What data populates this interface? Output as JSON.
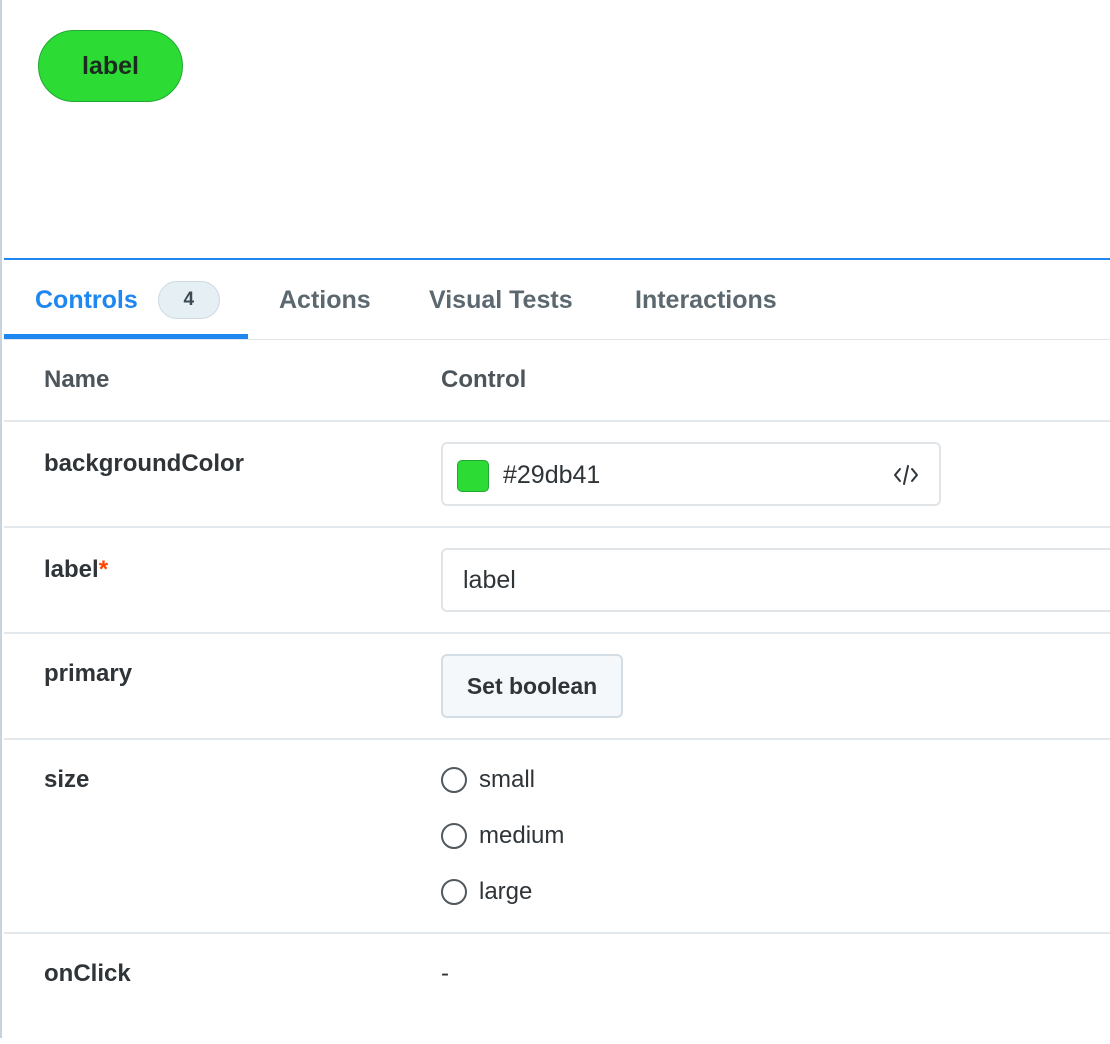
{
  "preview": {
    "button_label": "label",
    "button_color": "#2cdc35"
  },
  "tabs": {
    "controls_label": "Controls",
    "controls_count": "4",
    "actions_label": "Actions",
    "visual_tests_label": "Visual Tests",
    "interactions_label": "Interactions"
  },
  "table": {
    "header_name": "Name",
    "header_control": "Control",
    "rows": {
      "background_color": {
        "name": "backgroundColor",
        "value": "#29db41",
        "swatch_color": "#2cdc35"
      },
      "label": {
        "name": "label",
        "required_mark": "*",
        "value": "label"
      },
      "primary": {
        "name": "primary",
        "button_label": "Set boolean"
      },
      "size": {
        "name": "size",
        "options": [
          "small",
          "medium",
          "large"
        ]
      },
      "on_click": {
        "name": "onClick",
        "value": "-"
      }
    }
  },
  "colors": {
    "accent": "#1e87f0",
    "required": "#ff4400"
  }
}
